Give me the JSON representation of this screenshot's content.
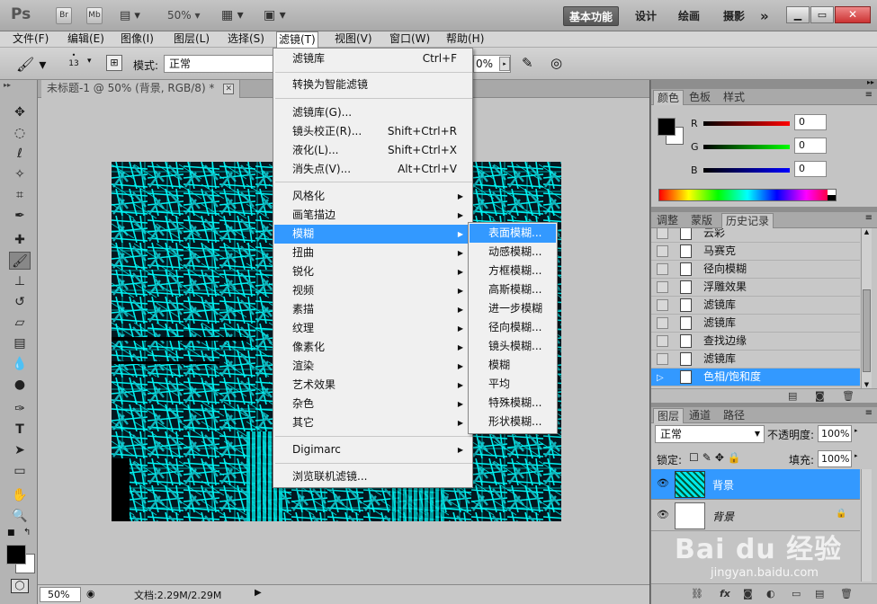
{
  "appbar": {
    "logo": "Ps",
    "br": "Br",
    "mb": "Mb",
    "zoom": "50%",
    "workspaces": [
      "基本功能",
      "设计",
      "绘画",
      "摄影"
    ],
    "more": "»"
  },
  "menubar": [
    "文件(F)",
    "编辑(E)",
    "图像(I)",
    "图层(L)",
    "选择(S)",
    "滤镜(T)",
    "视图(V)",
    "窗口(W)",
    "帮助(H)"
  ],
  "options": {
    "brush_size": "13",
    "mode_label": "模式:",
    "mode_value": "正常",
    "opacity_value": "0%"
  },
  "document": {
    "tab_title": "未标题-1 @ 50% (背景, RGB/8) *",
    "zoom": "50%",
    "doc_info": "文档:2.29M/2.29M"
  },
  "filter_menu": {
    "top": [
      {
        "label": "滤镜库",
        "shortcut": "Ctrl+F"
      }
    ],
    "convert": "转换为智能滤镜",
    "mid": [
      {
        "label": "滤镜库(G)...",
        "shortcut": ""
      },
      {
        "label": "镜头校正(R)...",
        "shortcut": "Shift+Ctrl+R"
      },
      {
        "label": "液化(L)...",
        "shortcut": "Shift+Ctrl+X"
      },
      {
        "label": "消失点(V)...",
        "shortcut": "Alt+Ctrl+V"
      }
    ],
    "subs": [
      "风格化",
      "画笔描边",
      "模糊",
      "扭曲",
      "锐化",
      "视频",
      "素描",
      "纹理",
      "像素化",
      "渲染",
      "艺术效果",
      "杂色",
      "其它"
    ],
    "digimarc": "Digimarc",
    "browse": "浏览联机滤镜...",
    "highlighted": "模糊"
  },
  "blur_menu": {
    "items": [
      "表面模糊...",
      "动感模糊...",
      "方框模糊...",
      "高斯模糊...",
      "进一步模糊",
      "径向模糊...",
      "镜头模糊...",
      "模糊",
      "平均",
      "特殊模糊...",
      "形状模糊..."
    ],
    "highlighted": "表面模糊..."
  },
  "color_panel": {
    "tabs": [
      "颜色",
      "色板",
      "样式"
    ],
    "channels": [
      {
        "label": "R",
        "value": "0",
        "color": "#cc0000"
      },
      {
        "label": "G",
        "value": "0",
        "color": "#00aa00"
      },
      {
        "label": "B",
        "value": "0",
        "color": "#0000cc"
      }
    ]
  },
  "history_panel": {
    "tabs": [
      "调整",
      "蒙版",
      "历史记录"
    ],
    "items": [
      "云彩",
      "马赛克",
      "径向模糊",
      "浮雕效果",
      "滤镜库",
      "滤镜库",
      "查找边缘",
      "滤镜库",
      "色相/饱和度"
    ],
    "selected": "色相/饱和度"
  },
  "layers_panel": {
    "tabs": [
      "图层",
      "通道",
      "路径"
    ],
    "blend": "正常",
    "opacity_label": "不透明度:",
    "opacity": "100%",
    "lock_label": "锁定:",
    "fill_label": "填充:",
    "fill": "100%",
    "layers": [
      {
        "name": "背景",
        "selected": true
      },
      {
        "name": "背景",
        "selected": false
      }
    ]
  },
  "watermark": {
    "brand": "Bai du 经验",
    "url": "jingyan.baidu.com"
  },
  "colors": {
    "accent": "#3399ff",
    "canvas": "#00e8e8"
  }
}
